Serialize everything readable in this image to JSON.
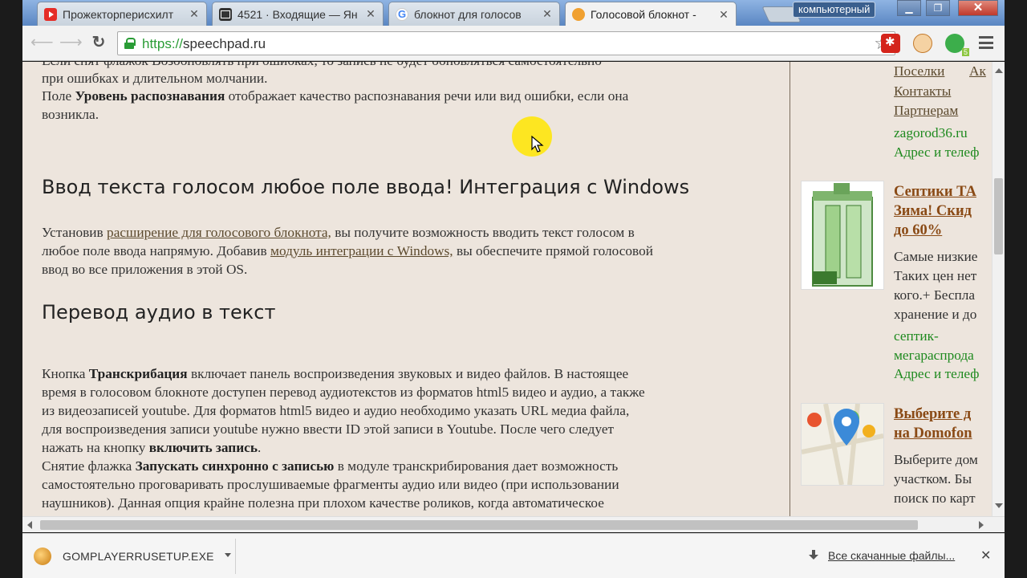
{
  "tabs": [
    {
      "title": "Прожекторперисхилт",
      "favicon": "youtube-icon"
    },
    {
      "title": "4521 · Входящие — Ян",
      "favicon": "mail-icon"
    },
    {
      "title": "блокнот для голосов",
      "favicon": "google-icon"
    },
    {
      "title": "Голосовой блокнот -",
      "favicon": "speechpad-icon",
      "active": true
    }
  ],
  "profile": "компьютерный",
  "address": {
    "scheme": "https://",
    "host": "speechpad.ru"
  },
  "article": {
    "cut_line": "Если снят флажок Возобновлять при ошибках, то запись не будет обновляться самостоятельно",
    "p_timeout_1": "при ошибках и длительном молчании.",
    "p_level_prefix": "Поле ",
    "p_level_bold": "Уровень распознавания",
    "p_level_rest": " отображает качество распознавания речи или вид ошибки, если она",
    "p_level_line2": "возникла.",
    "h_windows": "Ввод текста голосом любое поле ввода! Интеграция с Windows",
    "p_ext_1": "Установив ",
    "p_ext_link1": "расширение для голосового блокнота,",
    "p_ext_2": " вы получите возможность вводить текст голосом в",
    "p_ext_3": "любое поле ввода напрямую. Добавив ",
    "p_ext_link2": "модуль интеграции с Windows,",
    "p_ext_4": " вы обеспечите прямой голосовой",
    "p_ext_5": "ввод во все приложения в этой OS.",
    "h_audio": "Перевод аудио в текст",
    "p_tr_1": "Кнопка ",
    "p_tr_bold": "Транскрибация",
    "p_tr_2": " включает панель воспроизведения звуковых и видео файлов. В настоящее",
    "p_tr_3": "время в голосовом блокноте доступен перевод аудиотекстов из форматов html5 видео и аудио, а также",
    "p_tr_4": "из видеозаписей youtube. Для форматов html5 видео и аудио необходимо указать URL медиа файла,",
    "p_tr_5": "для воспроизведения записи youtube нужно ввести ID этой записи в Youtube. После чего следует",
    "p_tr_6": "нажать на кнопку ",
    "p_tr_bold2": "включить запись",
    "p_tr_7": ".",
    "p_sync_1": "Снятие флажка ",
    "p_sync_bold": "Запускать синхронно с записью",
    "p_sync_2": " в модуле транскрибирования дает возможность",
    "p_sync_3": "самостоятельно проговаривать прослушиваемые фрагменты аудио или видео (при использовании",
    "p_sync_4": "наушников). Данная опция крайне полезна при плохом качестве роликов, когда автоматическое"
  },
  "sidebar": {
    "link1": "Поселки",
    "link1b": "Ак",
    "link2": "Контакты",
    "link3": "Партнерам",
    "site1": "zagorod36.ru",
    "addr1": "Адрес и телеф",
    "ad1_title_1": "Септики ТА",
    "ad1_title_2": "Зима! Скид",
    "ad1_title_3": "до 60%",
    "ad1_text_1": "Самые низкие",
    "ad1_text_2": "Таких цен нет",
    "ad1_text_3": "кого.+ Беспла",
    "ad1_text_4": "хранение и до",
    "ad1_site_1": "септик-",
    "ad1_site_2": "мегараспрода",
    "ad1_addr": "Адрес и телеф",
    "ad2_title_1": "Выберите д",
    "ad2_title_2": "на Domofon",
    "ad2_text_1": "Выберите дом",
    "ad2_text_2": "участком. Бы",
    "ad2_text_3": "поиск по карт"
  },
  "downloads": {
    "file": "GOMPLAYERRUSETUP.EXE",
    "all": "Все скачанные файлы..."
  },
  "colors": {
    "page_bg": "#ede5dd",
    "link": "#5c4a2e",
    "green": "#1f8a1f",
    "ad_title": "#8a4a15",
    "url_scheme": "#2a9c36"
  }
}
